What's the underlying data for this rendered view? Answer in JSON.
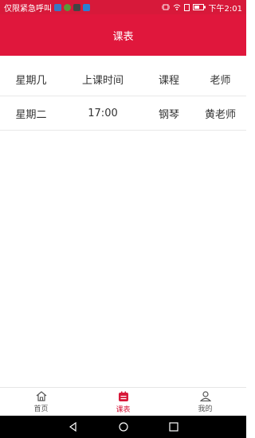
{
  "status_bar": {
    "left_text": "仅限紧急呼叫",
    "right_text": "下午2:01"
  },
  "header": {
    "title": "课表"
  },
  "table": {
    "columns": [
      "星期几",
      "上课时间",
      "课程",
      "老师"
    ],
    "rows": [
      [
        "星期二",
        "17:00",
        "钢琴",
        "黄老师"
      ]
    ]
  },
  "tabbar": {
    "tabs": [
      {
        "label": "首页",
        "icon": "home-icon"
      },
      {
        "label": "课表",
        "icon": "schedule-icon",
        "active": true
      },
      {
        "label": "我的",
        "icon": "user-icon"
      }
    ]
  },
  "colors": {
    "accent": "#e0173c",
    "status": "#d7193a"
  }
}
